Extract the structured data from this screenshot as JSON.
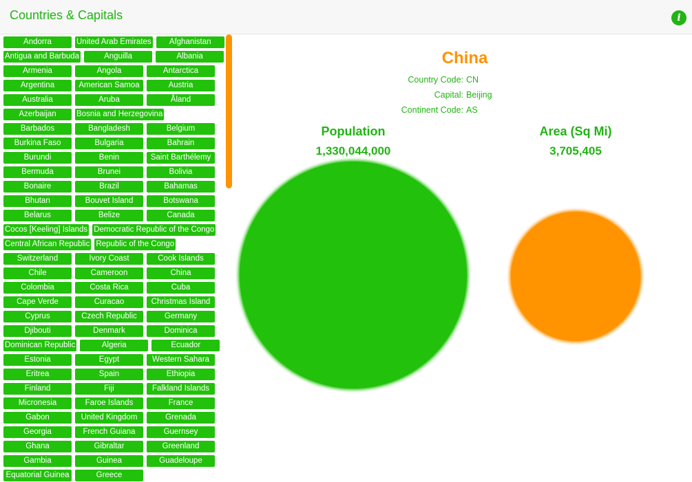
{
  "app": {
    "title": "Countries & Capitals",
    "info_icon": "info-icon",
    "info_glyph": "i"
  },
  "colors": {
    "accent_green": "#22c10b",
    "accent_orange": "#ff9300"
  },
  "countries": [
    [
      "Andorra",
      "United Arab Emirates",
      "Afghanistan"
    ],
    [
      "Antigua and Barbuda",
      "Anguilla",
      "Albania"
    ],
    [
      "Armenia",
      "Angola",
      "Antarctica"
    ],
    [
      "Argentina",
      "American Samoa",
      "Austria"
    ],
    [
      "Australia",
      "Aruba",
      "Åland"
    ],
    [
      "Azerbaijan",
      "Bosnia and Herzegovina"
    ],
    [
      "Barbados",
      "Bangladesh",
      "Belgium"
    ],
    [
      "Burkina Faso",
      "Bulgaria",
      "Bahrain"
    ],
    [
      "Burundi",
      "Benin",
      "Saint Barthélemy"
    ],
    [
      "Bermuda",
      "Brunei",
      "Bolivia"
    ],
    [
      "Bonaire",
      "Brazil",
      "Bahamas"
    ],
    [
      "Bhutan",
      "Bouvet Island",
      "Botswana"
    ],
    [
      "Belarus",
      "Belize",
      "Canada"
    ],
    [
      "Cocos [Keeling] Islands",
      "Democratic Republic of the Congo"
    ],
    [
      "Central African Republic",
      "Republic of the Congo"
    ],
    [
      "Switzerland",
      "Ivory Coast",
      "Cook Islands"
    ],
    [
      "Chile",
      "Cameroon",
      "China"
    ],
    [
      "Colombia",
      "Costa Rica",
      "Cuba"
    ],
    [
      "Cape Verde",
      "Curacao",
      "Christmas Island"
    ],
    [
      "Cyprus",
      "Czech Republic",
      "Germany"
    ],
    [
      "Djibouti",
      "Denmark",
      "Dominica"
    ],
    [
      "Dominican Republic",
      "Algeria",
      "Ecuador"
    ],
    [
      "Estonia",
      "Egypt",
      "Western Sahara"
    ],
    [
      "Eritrea",
      "Spain",
      "Ethiopia"
    ],
    [
      "Finland",
      "Fiji",
      "Falkland Islands"
    ],
    [
      "Micronesia",
      "Faroe Islands",
      "France"
    ],
    [
      "Gabon",
      "United Kingdom",
      "Grenada"
    ],
    [
      "Georgia",
      "French Guiana",
      "Guernsey"
    ],
    [
      "Ghana",
      "Gibraltar",
      "Greenland"
    ],
    [
      "Gambia",
      "Guinea",
      "Guadeloupe"
    ],
    [
      "Equatorial Guinea",
      "Greece"
    ]
  ],
  "detail": {
    "country_name": "China",
    "info": [
      {
        "label": "Country Code:",
        "value": "CN"
      },
      {
        "label": "Capital:",
        "value": "Beijing"
      },
      {
        "label": "Continent Code:",
        "value": "AS"
      }
    ],
    "population": {
      "label": "Population",
      "value": "1,330,044,000"
    },
    "area": {
      "label": "Area (Sq Mi)",
      "value": "3,705,405"
    }
  }
}
